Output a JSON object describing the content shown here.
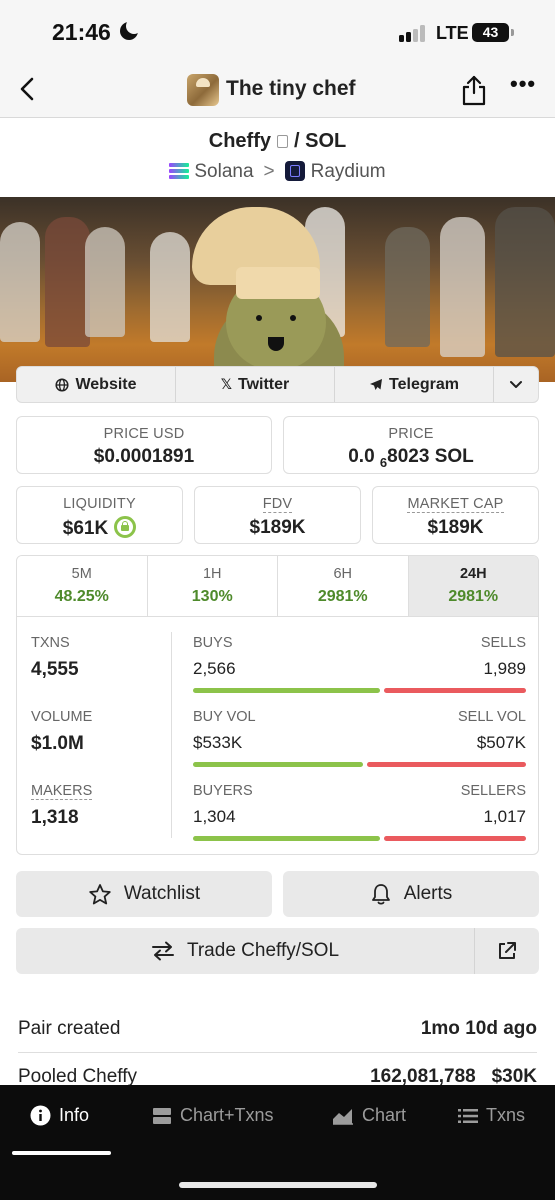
{
  "status_bar": {
    "time": "21:46",
    "network": "LTE",
    "battery": "43"
  },
  "nav": {
    "title": "The tiny chef"
  },
  "pair": {
    "base": "Cheffy",
    "separator": "/ SOL"
  },
  "chain": {
    "network": "Solana",
    "dex": "Raydium"
  },
  "links": {
    "website": "Website",
    "twitter": "Twitter",
    "telegram": "Telegram"
  },
  "prices": {
    "price_usd_label": "PRICE USD",
    "price_usd": "$0.0001891",
    "price_label": "PRICE",
    "price_prefix": "0.0",
    "price_zeros": "6",
    "price_suffix": "8023 SOL"
  },
  "metrics": {
    "liquidity_label": "LIQUIDITY",
    "liquidity": "$61K",
    "fdv_label": "FDV",
    "fdv": "$189K",
    "mcap_label": "MARKET CAP",
    "mcap": "$189K"
  },
  "timeframes": [
    {
      "label": "5M",
      "value": "48.25%"
    },
    {
      "label": "1H",
      "value": "130%"
    },
    {
      "label": "6H",
      "value": "2981%"
    },
    {
      "label": "24H",
      "value": "2981%"
    }
  ],
  "active_timeframe": "24H",
  "stats": {
    "txns_label": "TXNS",
    "txns": "4,555",
    "buys_label": "BUYS",
    "buys": "2,566",
    "sells_label": "SELLS",
    "sells": "1,989",
    "volume_label": "VOLUME",
    "volume": "$1.0M",
    "buy_vol_label": "BUY VOL",
    "buy_vol": "$533K",
    "sell_vol_label": "SELL VOL",
    "sell_vol": "$507K",
    "makers_label": "MAKERS",
    "makers": "1,318",
    "buyers_label": "BUYERS",
    "buyers": "1,304",
    "sellers_label": "SELLERS",
    "sellers": "1,017",
    "buys_share": 0.563,
    "buy_vol_share": 0.512,
    "buyers_share": 0.562
  },
  "actions": {
    "watchlist": "Watchlist",
    "alerts": "Alerts",
    "trade": "Trade Cheffy/SOL"
  },
  "info": [
    {
      "label": "Pair created",
      "value": "1mo 10d ago"
    },
    {
      "label": "Pooled Cheffy",
      "value": "162,081,788   $30K"
    }
  ],
  "bottom_tabs": [
    {
      "label": "Info",
      "icon": "info-icon"
    },
    {
      "label": "Chart+Txns",
      "icon": "split-view-icon"
    },
    {
      "label": "Chart",
      "icon": "chart-icon"
    },
    {
      "label": "Txns",
      "icon": "list-icon"
    }
  ],
  "colors": {
    "green": "#8cc34a",
    "red": "#ea5a5e",
    "positive_text": "#4e8a2b"
  }
}
